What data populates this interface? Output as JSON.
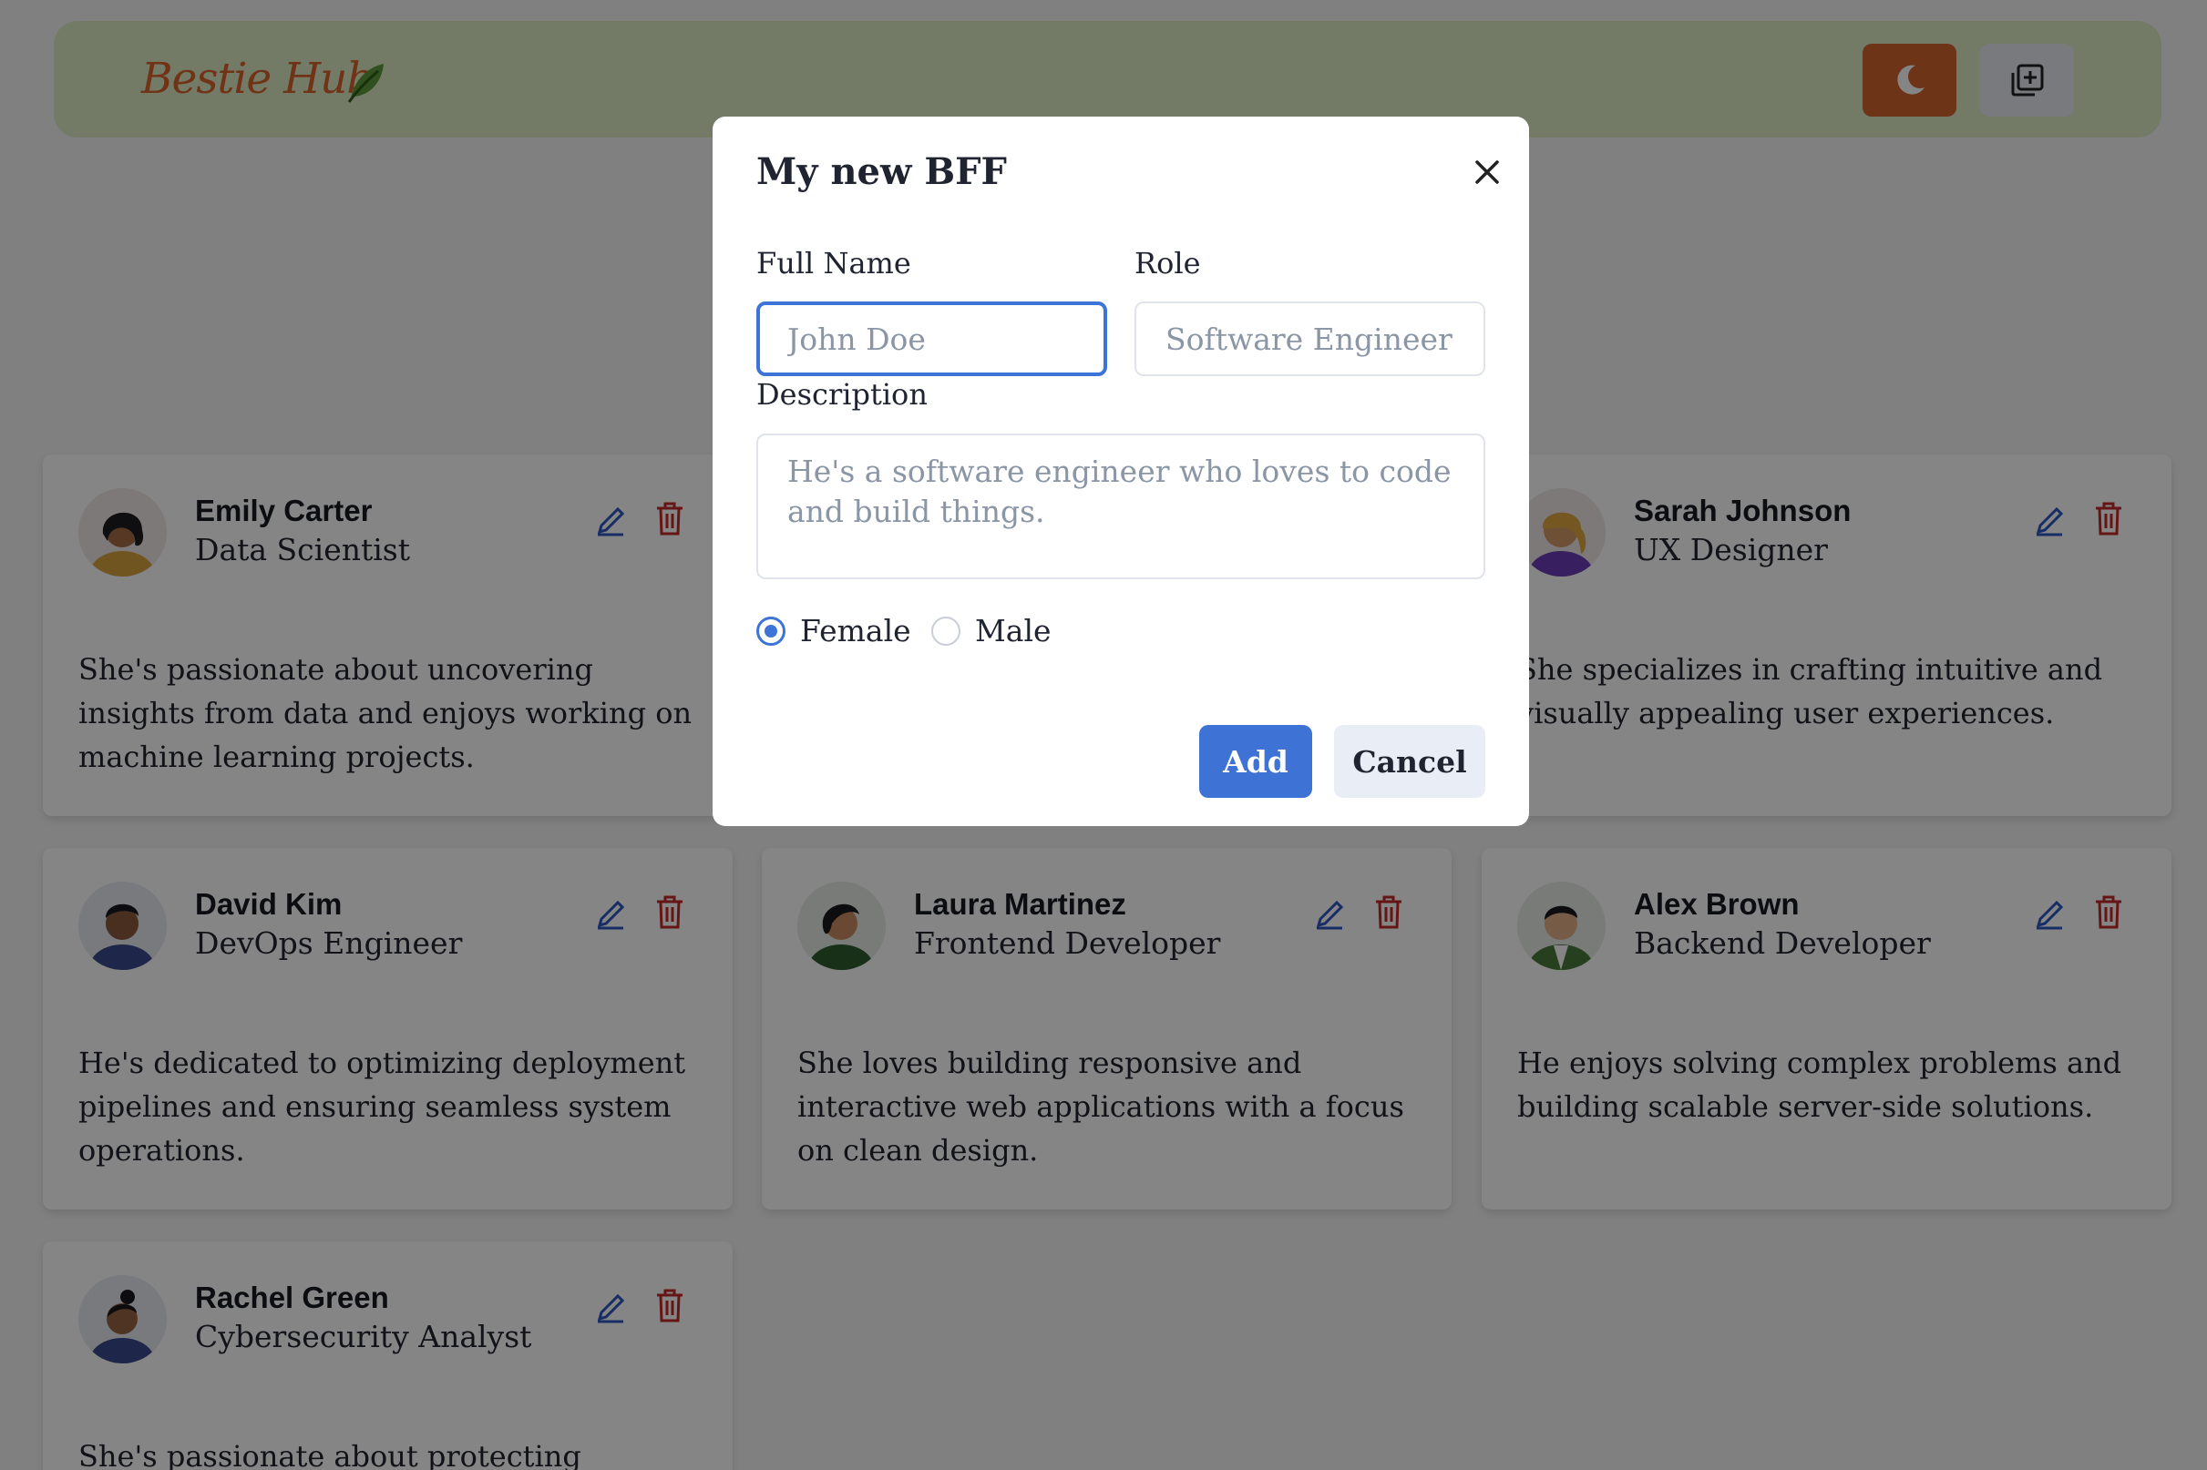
{
  "header": {
    "logo_text": "Bestie Hub",
    "logo_icon": "leaf-icon",
    "theme_toggle_icon": "moon-icon",
    "add_button_icon": "add-square-icon",
    "accent_color": "#d4642c"
  },
  "friends": [
    {
      "name": "Emily Carter",
      "role": "Data Scientist",
      "description": "She's passionate about uncovering insights from data and enjoys working on machine learning projects.",
      "gender": "female"
    },
    {
      "name": "",
      "role": "",
      "description": "",
      "gender": ""
    },
    {
      "name": "Sarah Johnson",
      "role": "UX Designer",
      "description": "She specializes in crafting intuitive and visually appealing user experiences.",
      "gender": "female"
    },
    {
      "name": "David Kim",
      "role": "DevOps Engineer",
      "description": "He's dedicated to optimizing deployment pipelines and ensuring seamless system operations.",
      "gender": "male"
    },
    {
      "name": "Laura Martinez",
      "role": "Frontend Developer",
      "description": "She loves building responsive and interactive web applications with a focus on clean design.",
      "gender": "female"
    },
    {
      "name": "Alex Brown",
      "role": "Backend Developer",
      "description": "He enjoys solving complex problems and building scalable server-side solutions.",
      "gender": "male"
    },
    {
      "name": "Rachel Green",
      "role": "Cybersecurity Analyst",
      "description": "She's passionate about protecting systems",
      "gender": "female"
    }
  ],
  "modal": {
    "title": "My new BFF",
    "full_name_label": "Full Name",
    "full_name_placeholder": "John Doe",
    "full_name_value": "",
    "role_label": "Role",
    "role_placeholder": "Software Engineer",
    "role_value": "",
    "description_label": "Description",
    "description_placeholder": "He's a software engineer who loves to code and build things.",
    "gender_options": [
      "Female",
      "Male"
    ],
    "gender_selected": "Female",
    "add_label": "Add",
    "cancel_label": "Cancel",
    "primary_color": "#3e72d4"
  }
}
